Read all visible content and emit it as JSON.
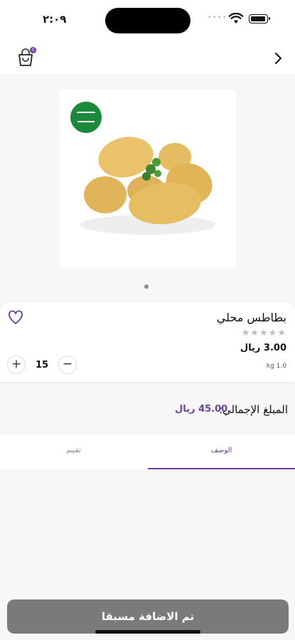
{
  "status": {
    "time": "٢:٠٩",
    "signal": "••••"
  },
  "nav": {
    "cart_badge": "0"
  },
  "product": {
    "name": "بطاطس محلي",
    "stars": "★★★★★",
    "price": "3.00 ريال",
    "unit": "kg 1.0",
    "quantity": "15"
  },
  "total": {
    "label": "المبلغ الإجمالي:",
    "value": "45.00 ريال"
  },
  "tabs": [
    {
      "label": "الوصف"
    },
    {
      "label": "تقييم"
    }
  ],
  "action": {
    "button_label": "تم الاضافة مسبقا"
  },
  "colors": {
    "accent": "#6b3fa0",
    "button": "#7a7a7a",
    "flag": "#1a8a3a"
  }
}
